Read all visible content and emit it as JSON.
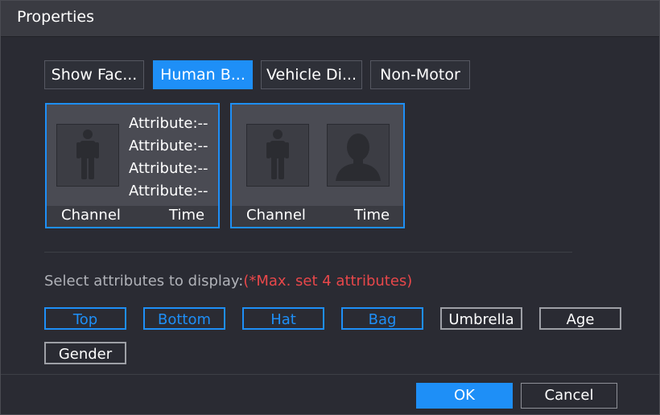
{
  "dialog": {
    "title": "Properties"
  },
  "tabs": [
    {
      "label": "Show Fac...",
      "active": false
    },
    {
      "label": "Human B...",
      "active": true
    },
    {
      "label": "Vehicle Di...",
      "active": false
    },
    {
      "label": "Non-Motor",
      "active": false
    }
  ],
  "cards": [
    {
      "attributes": [
        "Attribute:--",
        "Attribute:--",
        "Attribute:--",
        "Attribute:--"
      ],
      "channel_label": "Channel",
      "time_label": "Time"
    },
    {
      "channel_label": "Channel",
      "time_label": "Time"
    }
  ],
  "select": {
    "label": "Select attributes to display:",
    "note": "(*Max. set 4 attributes)"
  },
  "attribute_options": [
    {
      "label": "Top",
      "selected": true
    },
    {
      "label": "Bottom",
      "selected": true
    },
    {
      "label": "Hat",
      "selected": true
    },
    {
      "label": "Bag",
      "selected": true
    },
    {
      "label": "Umbrella",
      "selected": false
    },
    {
      "label": "Age",
      "selected": false
    },
    {
      "label": "Gender",
      "selected": false
    }
  ],
  "buttons": {
    "ok": "OK",
    "cancel": "Cancel"
  },
  "colors": {
    "accent": "#1e8ff7",
    "warning": "#e8474a",
    "panel": "#2a2b33"
  },
  "icons": {
    "body": "human-body-icon",
    "face": "human-face-icon"
  }
}
